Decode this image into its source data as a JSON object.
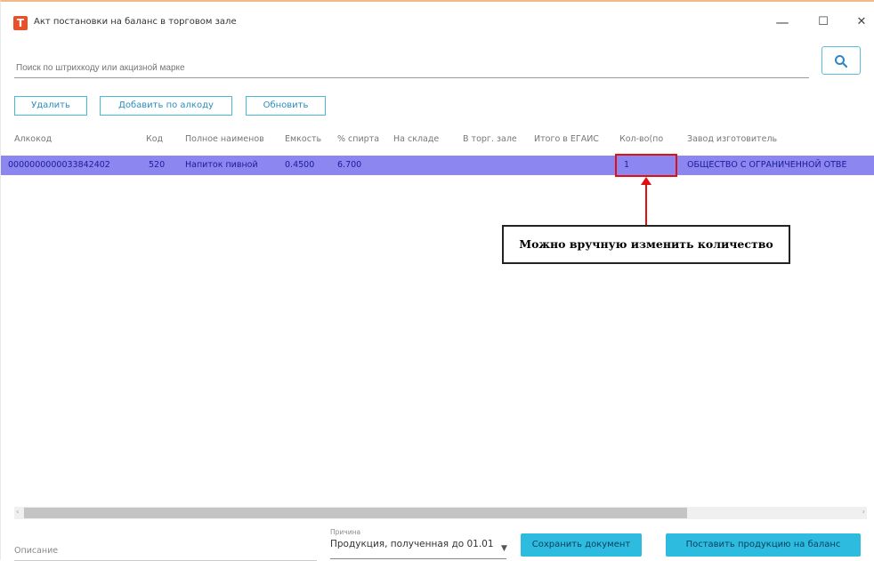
{
  "window": {
    "title": "Акт постановки на баланс в торговом зале",
    "app_icon": "Т",
    "minimize_symbol": "—",
    "maximize_symbol": "☐",
    "close_symbol": "✕"
  },
  "search": {
    "placeholder": "Поиск по штрихкоду или акцизной марке",
    "icon": "search-icon"
  },
  "toolbar": {
    "delete_label": "Удалить",
    "add_by_code_label": "Добавить по алкоду",
    "refresh_label": "Обновить"
  },
  "grid": {
    "columns": [
      "Алкокод",
      "Код",
      "Полное наименов",
      "Емкость",
      "% спирта",
      "На складе",
      "В торг. зале",
      "Итого в ЕГАИС",
      "Кол-во(по",
      "Завод изготовитель"
    ],
    "rows": [
      {
        "alcocode": "0000000000033842402",
        "code": "520",
        "name": "Напиток пивной",
        "capacity": "0.4500",
        "alcohol": "6.700",
        "in_stock": "",
        "in_hall": "",
        "total_egais": "",
        "quantity": "1",
        "manufacturer": "ОБЩЕСТВО С ОГРАНИЧЕННОЙ ОТВЕ"
      }
    ]
  },
  "annotation": {
    "text": "Можно вручную изменить количество"
  },
  "footer": {
    "description_placeholder": "Описание",
    "reason_label": "Причина",
    "reason_value": "Продукция, полученная до 01.01",
    "save_label": "Сохранить документ",
    "post_label": "Поставить продукцию на баланс"
  },
  "colors": {
    "accent": "#2dbcdf",
    "selected_row": "#8c86f0",
    "highlight": "#e01010",
    "app_icon": "#e8502a"
  }
}
